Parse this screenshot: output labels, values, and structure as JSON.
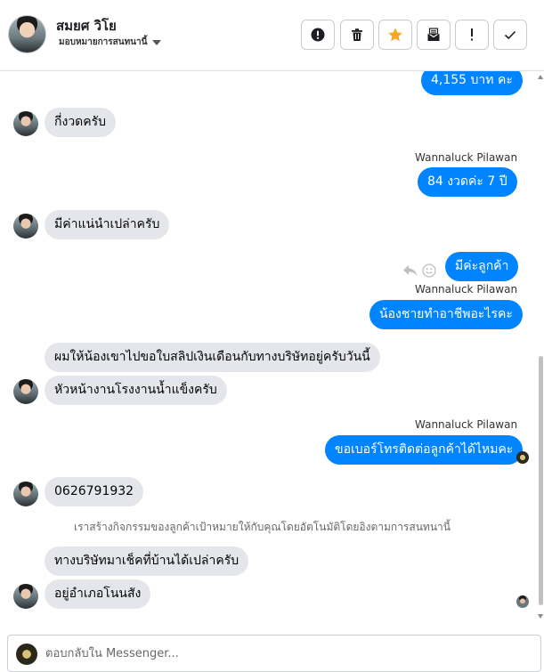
{
  "header": {
    "contact_name": "สมยศ วิโย",
    "assign_label": "มอบหมายการสนทนานี้",
    "toolbar": [
      {
        "icon": "alert-circle-icon",
        "name": "mark-spam-button"
      },
      {
        "icon": "trash-icon",
        "name": "delete-button"
      },
      {
        "icon": "star-icon",
        "name": "star-button",
        "color": "#f5a623"
      },
      {
        "icon": "mail-archive-icon",
        "name": "mark-unread-button"
      },
      {
        "icon": "exclamation-icon",
        "name": "follow-up-button"
      },
      {
        "icon": "checkmark-icon",
        "name": "done-button"
      }
    ]
  },
  "messages": [
    {
      "id": "m1",
      "dir": "out",
      "text": "4,155 บาท คะ"
    },
    {
      "id": "m2",
      "dir": "in",
      "text": "กี่งวดครับ"
    },
    {
      "id": "m3",
      "dir": "out",
      "sender": "Wannaluck Pilawan",
      "text": "84 งวดค่ะ  7 ปี"
    },
    {
      "id": "m4",
      "dir": "in",
      "text": "มีค่าแน่นำเปล่าครับ"
    },
    {
      "id": "m5",
      "dir": "out",
      "text": "มีค่ะลูกค้า"
    },
    {
      "id": "m6",
      "dir": "out",
      "sender": "Wannaluck Pilawan",
      "text": "น้องชายทำอาชีพอะไรคะ"
    },
    {
      "id": "m7",
      "dir": "in",
      "text": "ผมให้น้องเขาไปขอใบสลิปเงินเดือนกับทางบริษัทอยู่ครับวันนี้"
    },
    {
      "id": "m8",
      "dir": "in",
      "text": "หัวหน้างานโรงงานน้ำแข็งครับ"
    },
    {
      "id": "m9",
      "dir": "out",
      "sender": "Wannaluck Pilawan",
      "text": "ขอเบอร์โทรติดต่อลูกค้าได้ไหมคะ"
    },
    {
      "id": "m10",
      "dir": "in",
      "text": "0626791932"
    },
    {
      "id": "m11",
      "dir": "in",
      "text": "ทางบริษัทมาเช็คที่บ้านได้เปล่าครับ"
    },
    {
      "id": "m12",
      "dir": "in",
      "text": "อยู่อำเภอโนนสัง"
    }
  ],
  "system_notice": "เราสร้างกิจกรรมของลูกค้าเป้าหมายให้กับคุณโดยอัตโนมัติโดยอิงตามการสนทนานี้",
  "composer": {
    "placeholder": "ตอบกลับใน Messenger..."
  },
  "colors": {
    "outgoing_bubble": "#0084ff",
    "incoming_bubble": "#e4e6eb",
    "star_accent": "#f5a623"
  }
}
